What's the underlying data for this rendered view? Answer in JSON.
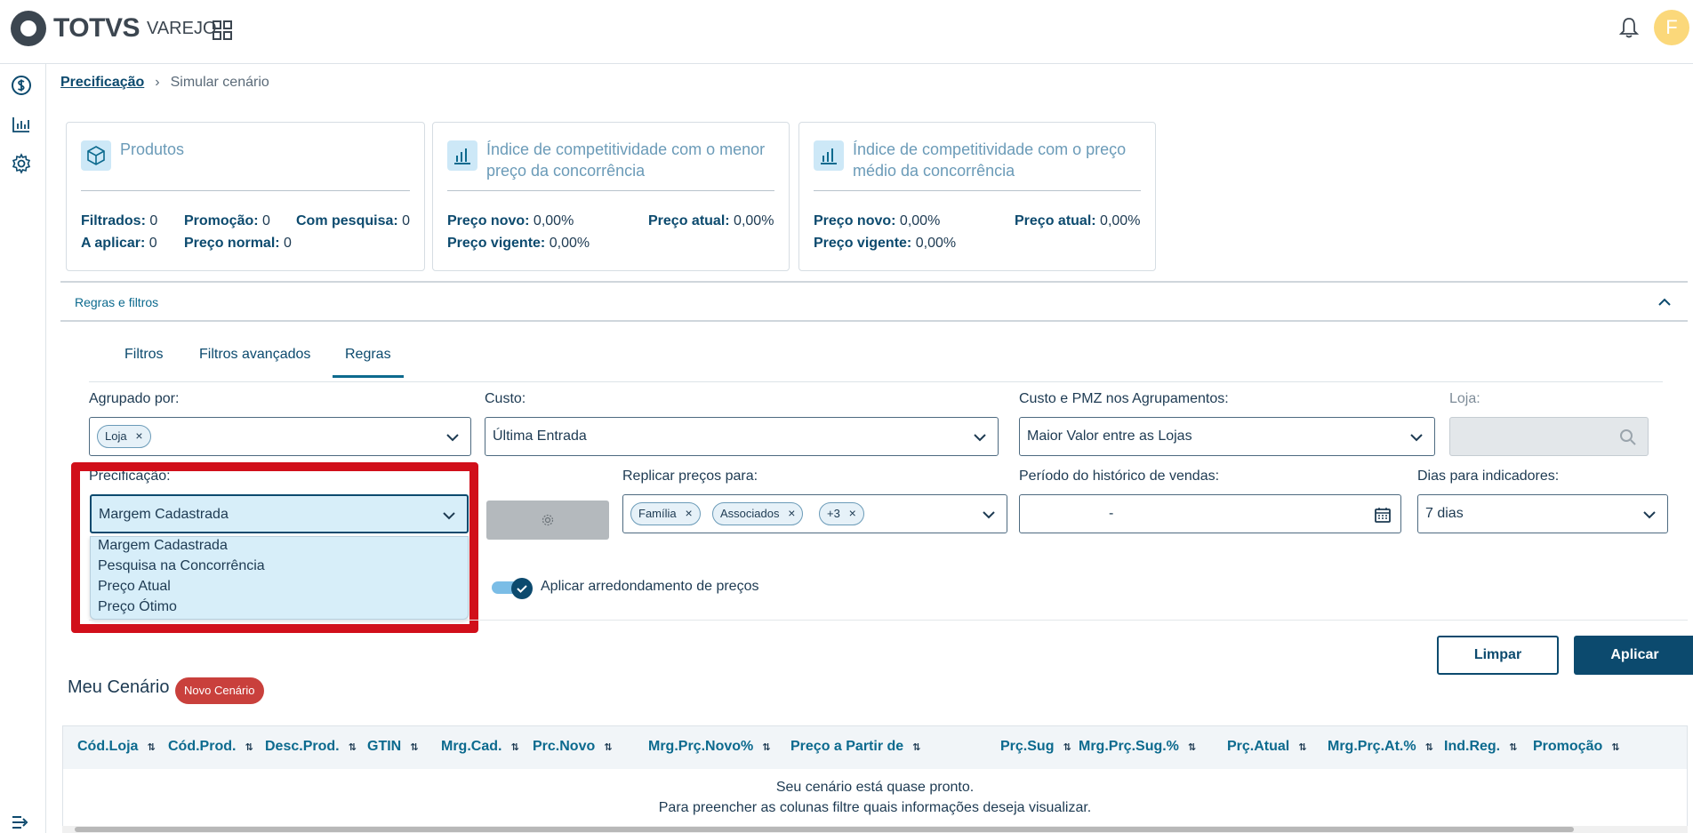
{
  "header": {
    "brand": "TOTVS",
    "brand_sub": "VAREJO",
    "avatar_initial": "F",
    "icons": [
      "grid-apps-icon",
      "bell-icon"
    ]
  },
  "sidebar": {
    "icons": [
      "dollar-icon",
      "bar-chart-icon",
      "gear-icon",
      "expand-menu-icon"
    ]
  },
  "breadcrumb": {
    "link": "Precificação",
    "current": "Simular cenário"
  },
  "cards": {
    "produtos": {
      "title": "Produtos",
      "filtrados_label": "Filtrados:",
      "filtrados_value": "0",
      "promocao_label": "Promoção:",
      "promocao_value": "0",
      "com_pesquisa_label": "Com pesquisa:",
      "com_pesquisa_value": "0",
      "a_aplicar_label": "A aplicar:",
      "a_aplicar_value": "0",
      "preco_normal_label": "Preço normal:",
      "preco_normal_value": "0"
    },
    "menor_preco": {
      "title_line1": "Índice de competitividade com o menor",
      "title_line2": "preço da concorrência",
      "preco_novo_label": "Preço novo:",
      "preco_novo_value": "0,00%",
      "preco_atual_label": "Preço atual:",
      "preco_atual_value": "0,00%",
      "preco_vigente_label": "Preço vigente:",
      "preco_vigente_value": "0,00%"
    },
    "preco_medio": {
      "title_line1": "Índice de competitividade com o preço",
      "title_line2": "médio da concorrência",
      "preco_novo_label": "Preço novo:",
      "preco_novo_value": "0,00%",
      "preco_atual_label": "Preço atual:",
      "preco_atual_value": "0,00%",
      "preco_vigente_label": "Preço vigente:",
      "preco_vigente_value": "0,00%"
    }
  },
  "panel": {
    "title": "Regras e filtros"
  },
  "tabs": [
    "Filtros",
    "Filtros avançados",
    "Regras"
  ],
  "active_tab": "Regras",
  "form": {
    "agrupado_label": "Agrupado por:",
    "agrupado_chip": "Loja",
    "custo_label": "Custo:",
    "custo_value": "Última Entrada",
    "custo_pmz_label": "Custo e PMZ nos Agrupamentos:",
    "custo_pmz_value": "Maior Valor entre as Lojas",
    "loja_label": "Loja:",
    "precificacao_label": "Precificação:",
    "precificacao_value": "Margem Cadastrada",
    "precificacao_options": [
      "Margem Cadastrada",
      "Pesquisa na Concorrência",
      "Preço Atual",
      "Preço Ótimo"
    ],
    "replicar_label": "Replicar preços para:",
    "replicar_chips": [
      "Família",
      "Associados",
      "+3"
    ],
    "periodo_label": "Período do histórico de vendas:",
    "periodo_value": "-",
    "dias_label": "Dias para indicadores:",
    "dias_value": "7 dias",
    "arredondamento_label": "Aplicar arredondamento de preços",
    "arredondamento_on": true
  },
  "actions": {
    "clear": "Limpar",
    "apply": "Aplicar"
  },
  "scenario": {
    "title": "Meu Cenário",
    "badge": "Novo Cenário"
  },
  "table": {
    "columns": [
      "Cód.Loja",
      "Cód.Prod.",
      "Desc.Prod.",
      "GTIN",
      "Mrg.Cad.",
      "Prc.Novo",
      "Mrg.Prç.Novo%",
      "Preço a Partir de",
      "Prç.Sug",
      "Mrg.Prç.Sug.%",
      "Prç.Atual",
      "Mrg.Prç.At.%",
      "Ind.Reg.",
      "Promoção"
    ],
    "empty_line1": "Seu cenário está quase pronto.",
    "empty_line2": "Para preencher as colunas filtre quais informações deseja visualizar."
  },
  "colors": {
    "primary": "#0c4a6e",
    "highlight": "#d10f1a",
    "badge": "#c9403c",
    "avatar": "#fbd87a"
  }
}
